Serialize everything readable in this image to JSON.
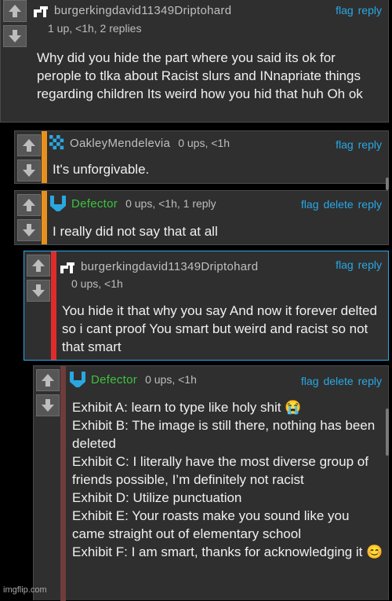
{
  "comments": [
    {
      "user": "burgerkingdavid11349Driptohard",
      "meta": "1 up, <1h, 2 replies",
      "actions": [
        "flag",
        "reply"
      ],
      "text": "Why did you hide the part where you said its ok for perople to tlka about Racist slurs and INnapriate things regarding children Its weird how you hid that huh Oh ok"
    },
    {
      "user": "OakleyMendelevia",
      "meta": "0 ups, <1h",
      "actions": [
        "flag",
        "reply"
      ],
      "text": "It's unforgivable."
    },
    {
      "user": "Defector",
      "meta": "0 ups, <1h, 1 reply",
      "actions": [
        "flag",
        "delete",
        "reply"
      ],
      "text": "I really did not say that at all"
    },
    {
      "user": "burgerkingdavid11349Driptohard",
      "meta": "0 ups, <1h",
      "actions": [
        "flag",
        "reply"
      ],
      "text": "You hide it that why you say And now it forever delted so i cant proof You smart but weird and racist so not that smart"
    },
    {
      "user": "Defector",
      "meta": "0 ups, <1h",
      "actions": [
        "flag",
        "delete",
        "reply"
      ],
      "lines": [
        "Exhibit A: learn to type like holy shit 😭",
        "Exhibit B: The image is still there, nothing has been deleted",
        "Exhibit C: I literally have the most diverse group of friends possible, I’m definitely not racist",
        "Exhibit D: Utilize punctuation",
        "Exhibit E: Your roasts make you sound like you came straight out of elementary school",
        "Exhibit F: I am smart, thanks for acknowledging it 😊"
      ]
    }
  ],
  "colors": {
    "link": "#28a9e6",
    "orange_bar": "#e8901e",
    "red_bar": "#e02b2b",
    "maroon_bar": "#6f3c3c",
    "defector_name": "#3ec23e",
    "defector_icon": "#2aa7e0"
  },
  "watermark": "imgflip.com"
}
